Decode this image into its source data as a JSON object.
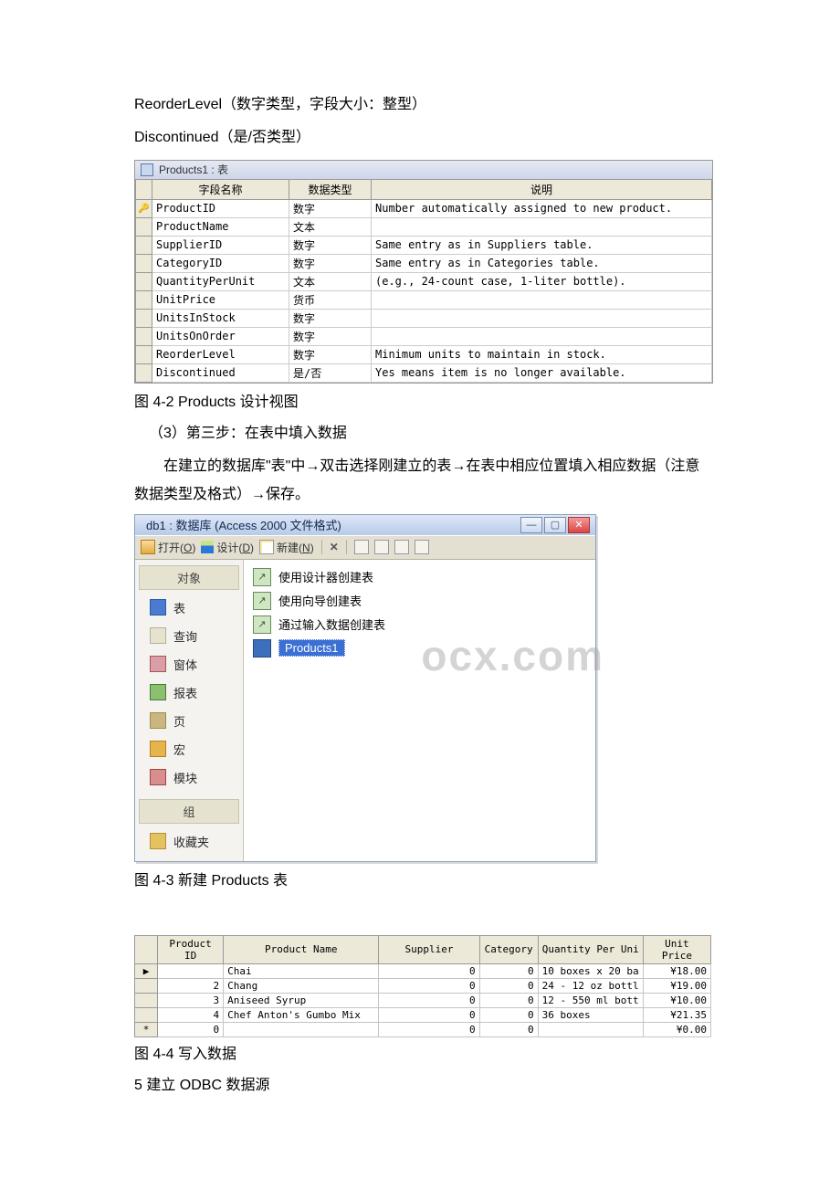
{
  "text": {
    "line1a": "ReorderLevel（数字类型，字段大小：整型）",
    "line1b": "Discontinued（是/否类型）",
    "fig1_title": "Products1 : 表",
    "fig1_headers": {
      "field": "字段名称",
      "type": "数据类型",
      "desc": "说明"
    },
    "fig1_caption": "图 4-2 Products 设计视图",
    "step3": "（3）第三步：在表中填入数据",
    "para3": "在建立的数据库\"表\"中→双击选择刚建立的表→在表中相应位置填入相应数据（注意数据类型及格式）→保存。",
    "fig2_title": "db1 : 数据库 (Access 2000 文件格式)",
    "toolbar": {
      "open": "打开(",
      "open_u": "O",
      "open2": ")",
      "design": "设计(",
      "design_u": "D",
      "design2": ")",
      "new": "新建(",
      "new_u": "N",
      "new2": ")"
    },
    "sidebar": {
      "objects": "对象",
      "items": [
        "表",
        "查询",
        "窗体",
        "报表",
        "页",
        "宏",
        "模块"
      ],
      "group": "组",
      "fav": "收藏夹"
    },
    "wizard": [
      "使用设计器创建表",
      "使用向导创建表",
      "通过输入数据创建表"
    ],
    "selected_table": "Products1",
    "watermark": "ocx.com",
    "fig2_caption": "图 4-3 新建 Products 表",
    "fig3_headers": [
      "Product ID",
      "Product Name",
      "Supplier",
      "Category",
      "Quantity Per Uni",
      "Unit Price"
    ],
    "fig3_caption": "图 4-4 写入数据",
    "section5": "5 建立 ODBC 数据源"
  },
  "design_rows": [
    {
      "pk": true,
      "name": "ProductID",
      "type": "数字",
      "desc": "Number automatically assigned to new product."
    },
    {
      "pk": false,
      "name": "ProductName",
      "type": "文本",
      "desc": ""
    },
    {
      "pk": false,
      "name": "SupplierID",
      "type": "数字",
      "desc": "Same entry as in Suppliers table."
    },
    {
      "pk": false,
      "name": "CategoryID",
      "type": "数字",
      "desc": "Same entry as in Categories table."
    },
    {
      "pk": false,
      "name": "QuantityPerUnit",
      "type": "文本",
      "desc": "(e.g., 24-count case, 1-liter bottle)."
    },
    {
      "pk": false,
      "name": "UnitPrice",
      "type": "货币",
      "desc": ""
    },
    {
      "pk": false,
      "name": "UnitsInStock",
      "type": "数字",
      "desc": ""
    },
    {
      "pk": false,
      "name": "UnitsOnOrder",
      "type": "数字",
      "desc": ""
    },
    {
      "pk": false,
      "name": "ReorderLevel",
      "type": "数字",
      "desc": "Minimum units to maintain in stock."
    },
    {
      "pk": false,
      "name": "Discontinued",
      "type": "是/否",
      "desc": "Yes means item is no longer available."
    }
  ],
  "data_rows": [
    {
      "sel": "▶",
      "id": "",
      "name": "Chai",
      "sup": "0",
      "cat": "0",
      "qpu": "10 boxes x 20 ba",
      "price": "¥18.00"
    },
    {
      "sel": "",
      "id": "2",
      "name": "Chang",
      "sup": "0",
      "cat": "0",
      "qpu": "24 - 12 oz bottl",
      "price": "¥19.00"
    },
    {
      "sel": "",
      "id": "3",
      "name": "Aniseed Syrup",
      "sup": "0",
      "cat": "0",
      "qpu": "12 - 550 ml bott",
      "price": "¥10.00"
    },
    {
      "sel": "",
      "id": "4",
      "name": "Chef Anton's Gumbo Mix",
      "sup": "0",
      "cat": "0",
      "qpu": "36 boxes",
      "price": "¥21.35"
    },
    {
      "sel": "*",
      "id": "0",
      "name": "",
      "sup": "0",
      "cat": "0",
      "qpu": "",
      "price": "¥0.00"
    }
  ]
}
